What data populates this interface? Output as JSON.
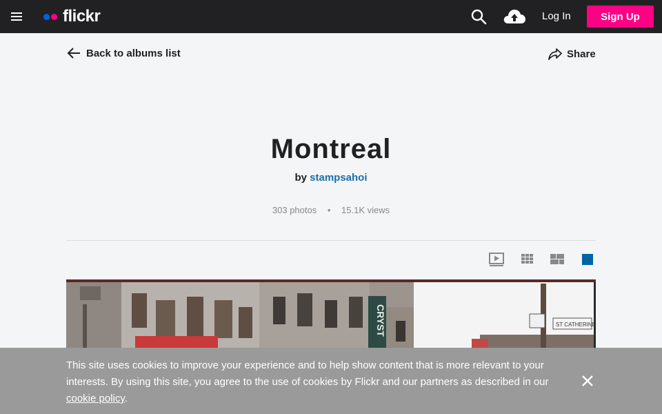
{
  "header": {
    "logo_text": "flickr",
    "logo_dot_colors": [
      "#0063dc",
      "#ff0084"
    ],
    "menu_icon": "hamburger-menu-icon",
    "search_icon": "search-icon",
    "upload_icon": "cloud-upload-icon",
    "login_label": "Log In",
    "signup_label": "Sign Up",
    "signup_color": "#ff0084"
  },
  "subnav": {
    "back_label": "Back to albums list",
    "back_icon": "arrow-left-icon",
    "share_label": "Share",
    "share_icon": "share-arrow-icon"
  },
  "album": {
    "title": "Montreal",
    "by_prefix": "by",
    "owner": "stampsahoi",
    "owner_color": "#1c6da8",
    "photo_count": "303 photos",
    "separator": "•",
    "views": "15.1K views"
  },
  "view_toggles": [
    {
      "name": "slideshow-view-icon",
      "active": false
    },
    {
      "name": "grid-view-icon",
      "active": false
    },
    {
      "name": "justified-view-icon",
      "active": false
    },
    {
      "name": "single-view-icon",
      "active": true
    }
  ],
  "hero": {
    "sign_text": "CRYST",
    "street_sign": "ST CATHERINE"
  },
  "cookie_banner": {
    "text": "This site uses cookies to improve your experience and to help show content that is more relevant to your interests. By using this site, you agree to the use of cookies by Flickr and our partners as described in our ",
    "link_label": "cookie policy",
    "suffix": ".",
    "close_icon": "close-icon"
  }
}
